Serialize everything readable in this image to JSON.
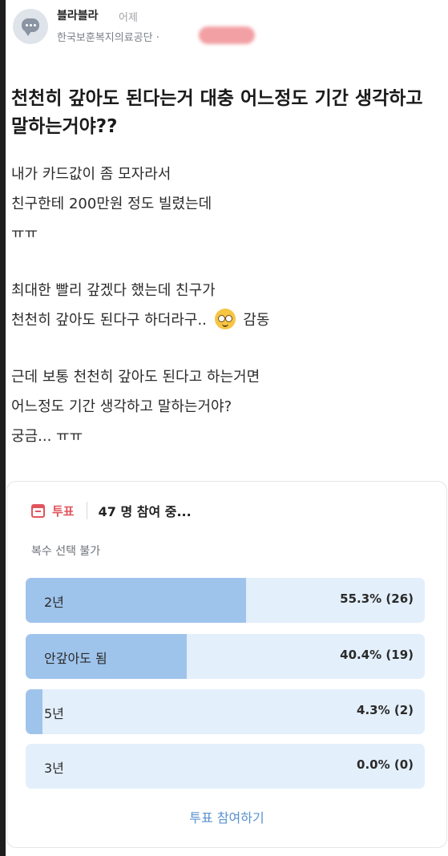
{
  "post": {
    "author": "블라블라",
    "time": "어제",
    "company": "한국보훈복지의료공단 ·",
    "title": "천천히 갚아도 된다는거 대충 어느정도 기간 생각하고 말하는거야??",
    "paragraphs": [
      {
        "lines": [
          "내가 카드값이 좀 모자라서",
          "친구한테 200만원 정도 빌렸는데",
          "ㅠㅠ"
        ]
      },
      {
        "lines": [
          "최대한 빨리 갚겠다 했는데 친구가"
        ],
        "emoji_line": {
          "before": "천천히 갚아도 된다구 하더라구..",
          "emoji": "pleading-face-icon",
          "after": "감동"
        }
      },
      {
        "lines": [
          "근데 보통 천천히 갚아도 된다고 하는거면",
          "어느정도 기간 생각하고 말하는거야?",
          "궁금... ㅠㅠ"
        ]
      }
    ]
  },
  "poll": {
    "label": "투표",
    "participants": "47 명 참여 중...",
    "subtitle": "복수 선택 불가",
    "options": [
      {
        "label": "2년",
        "result": "55.3% (26)",
        "percent": 55.3
      },
      {
        "label": "안갚아도 됨",
        "result": "40.4% (19)",
        "percent": 40.4
      },
      {
        "label": "5년",
        "result": "4.3% (2)",
        "percent": 4.3
      },
      {
        "label": "3년",
        "result": "0.0% (0)",
        "percent": 0.0
      }
    ],
    "vote_button": "투표 참여하기"
  },
  "colors": {
    "accent_red": "#e0555c",
    "bar_fill": "#9fc4ec",
    "bar_track": "#e3effb",
    "link_blue": "#5a91cf"
  }
}
